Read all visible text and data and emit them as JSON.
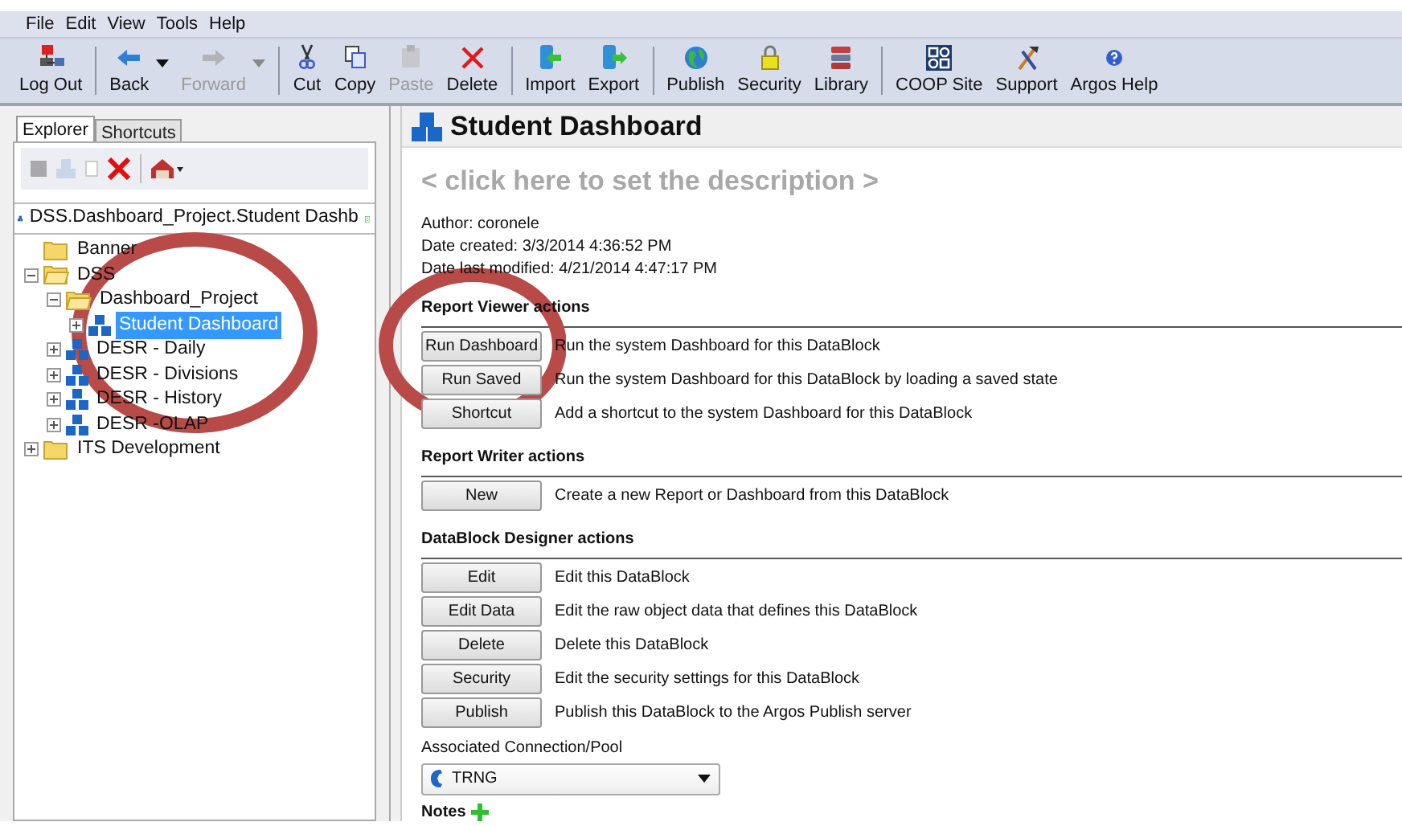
{
  "menu": [
    "File",
    "Edit",
    "View",
    "Tools",
    "Help"
  ],
  "toolbar": [
    [
      {
        "label": "Log Out",
        "disabled": false,
        "dropdown": false
      }
    ],
    [
      {
        "label": "Back",
        "disabled": false,
        "dropdown": true
      },
      {
        "label": "Forward",
        "disabled": true,
        "dropdown": true
      }
    ],
    [
      {
        "label": "Cut",
        "disabled": false,
        "dropdown": false
      },
      {
        "label": "Copy",
        "disabled": false,
        "dropdown": false
      },
      {
        "label": "Paste",
        "disabled": true,
        "dropdown": false
      },
      {
        "label": "Delete",
        "disabled": false,
        "dropdown": false
      }
    ],
    [
      {
        "label": "Import",
        "disabled": false,
        "dropdown": false
      },
      {
        "label": "Export",
        "disabled": false,
        "dropdown": false
      }
    ],
    [
      {
        "label": "Publish",
        "disabled": false,
        "dropdown": false
      },
      {
        "label": "Security",
        "disabled": false,
        "dropdown": false
      },
      {
        "label": "Library",
        "disabled": false,
        "dropdown": false
      }
    ],
    [
      {
        "label": "COOP Site",
        "disabled": false,
        "dropdown": false
      },
      {
        "label": "Support",
        "disabled": false,
        "dropdown": false
      },
      {
        "label": "Argos Help",
        "disabled": false,
        "dropdown": false
      }
    ]
  ],
  "sidebar": {
    "tabs": [
      {
        "label": "Explorer",
        "selected": true
      },
      {
        "label": "Shortcuts",
        "selected": false
      }
    ],
    "path": "DSS.Dashboard_Project.Student Dashb",
    "tree": [
      {
        "label": "Banner",
        "kind": "folder",
        "expanded": false,
        "selected": false
      },
      {
        "label": "DSS",
        "kind": "folder",
        "expanded": true,
        "selected": false,
        "children": [
          {
            "label": "Dashboard_Project",
            "kind": "folder",
            "expanded": true,
            "selected": false,
            "children": [
              {
                "label": "Student Dashboard",
                "kind": "datablock",
                "expanded": false,
                "selected": true
              }
            ]
          },
          {
            "label": "DESR - Daily",
            "kind": "datablock",
            "expanded": false,
            "selected": false
          },
          {
            "label": "DESR - Divisions",
            "kind": "datablock",
            "expanded": false,
            "selected": false
          },
          {
            "label": "DESR - History",
            "kind": "datablock",
            "expanded": false,
            "selected": false
          },
          {
            "label": "DESR -OLAP",
            "kind": "datablock",
            "expanded": false,
            "selected": false
          }
        ]
      },
      {
        "label": "ITS Development",
        "kind": "folder",
        "expanded": false,
        "selected": false
      }
    ]
  },
  "main": {
    "title": "Student Dashboard",
    "description": "< click here to set the description >",
    "info": [
      "Author: coronele",
      "Date created: 3/3/2014 4:36:52 PM",
      "Date last modified: 4/21/2014 4:47:17 PM"
    ],
    "sections": [
      {
        "heading": "Report Viewer actions",
        "actions": [
          {
            "button": "Run Dashboard",
            "text": "Run the system Dashboard for this DataBlock"
          },
          {
            "button": "Run Saved",
            "text": "Run the system Dashboard for this DataBlock by loading a saved state"
          },
          {
            "button": "Shortcut",
            "text": "Add a shortcut to the system Dashboard for this DataBlock"
          }
        ]
      },
      {
        "heading": "Report Writer actions",
        "actions": [
          {
            "button": "New",
            "text": "Create a new Report or Dashboard from this DataBlock"
          }
        ]
      },
      {
        "heading": "DataBlock Designer actions",
        "actions": [
          {
            "button": "Edit",
            "text": "Edit this DataBlock"
          },
          {
            "button": "Edit Data",
            "text": "Edit the raw object data that defines this DataBlock"
          },
          {
            "button": "Delete",
            "text": "Delete this DataBlock"
          },
          {
            "button": "Security",
            "text": "Edit the security settings for this DataBlock"
          },
          {
            "button": "Publish",
            "text": "Publish this DataBlock to the Argos Publish server"
          }
        ]
      }
    ],
    "connection_label": "Associated Connection/Pool",
    "connection_value": "TRNG",
    "notes_label": "Notes"
  }
}
